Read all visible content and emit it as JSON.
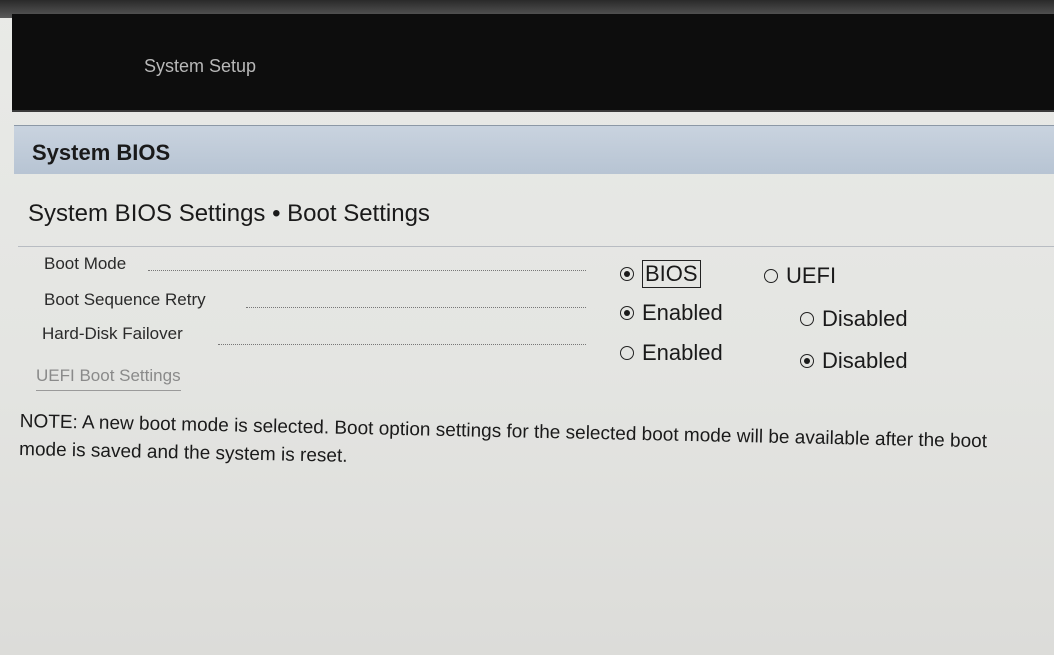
{
  "header": {
    "title": "System Setup"
  },
  "section": {
    "title": "System BIOS"
  },
  "page": {
    "title": "System BIOS Settings • Boot Settings"
  },
  "settings": [
    {
      "label": "Boot Mode",
      "options": [
        {
          "label": "BIOS",
          "selected": true
        },
        {
          "label": "UEFI",
          "selected": false
        }
      ]
    },
    {
      "label": "Boot Sequence Retry",
      "options": [
        {
          "label": "Enabled",
          "selected": true
        },
        {
          "label": "Disabled",
          "selected": false
        }
      ]
    },
    {
      "label": "Hard-Disk Failover",
      "options": [
        {
          "label": "Enabled",
          "selected": false
        },
        {
          "label": "Disabled",
          "selected": true
        }
      ]
    }
  ],
  "links": {
    "uefi_boot_settings": "UEFI Boot Settings"
  },
  "note": "NOTE: A new boot mode is selected. Boot option settings for the selected boot mode will be available after the boot mode is saved and the system is reset."
}
